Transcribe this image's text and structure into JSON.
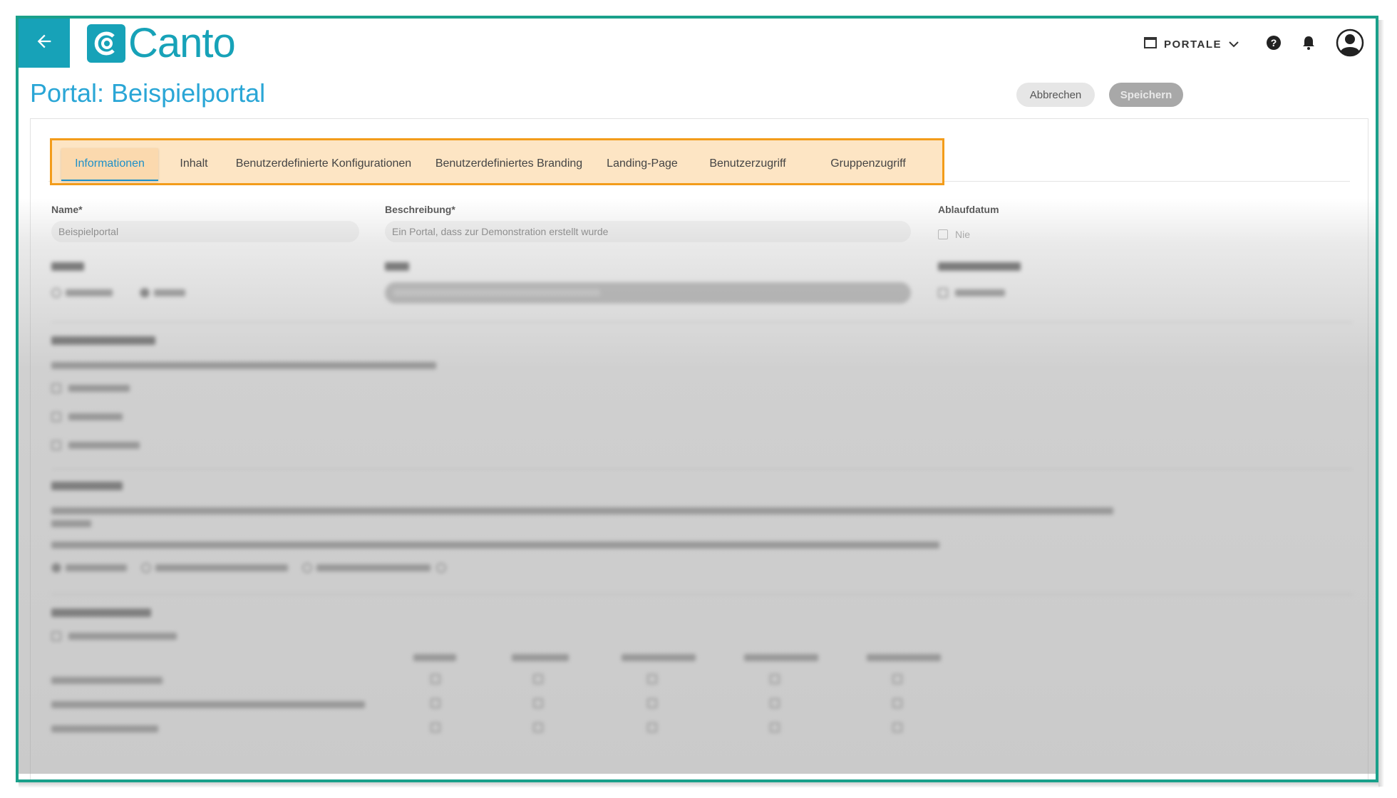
{
  "logo": {
    "text": "Canto"
  },
  "topbar": {
    "portale_label": "PORTALE"
  },
  "page": {
    "title": "Portal: Beispielportal"
  },
  "actions": {
    "cancel_label": "Abbrechen",
    "save_label": "Speichern"
  },
  "tabs": [
    {
      "label": "Informationen",
      "active": true
    },
    {
      "label": "Inhalt"
    },
    {
      "label": "Benutzerdefinierte Konfigurationen"
    },
    {
      "label": "Benutzerdefiniertes Branding"
    },
    {
      "label": "Landing-Page"
    },
    {
      "label": "Benutzerzugriff"
    },
    {
      "label": "Gruppenzugriff"
    }
  ],
  "form": {
    "name_label": "Name*",
    "name_value": "Beispielportal",
    "description_label": "Beschreibung*",
    "description_value": "Ein Portal, dass zur Demonstration erstellt wurde",
    "expiry_label": "Ablaufdatum",
    "expiry_never": "Nie"
  },
  "colors": {
    "accent": "#17a2b8",
    "title": "#2aa6d6",
    "highlight_border": "#f39c1a",
    "frame": "#1aa08a"
  }
}
